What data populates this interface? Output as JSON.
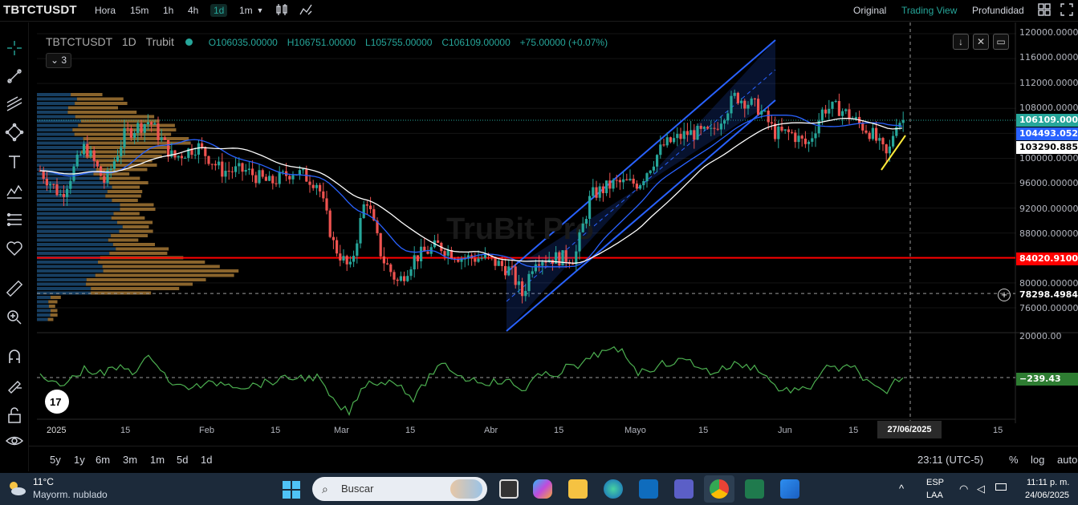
{
  "toolbar": {
    "symbol": "TBTCTUSDT",
    "timeframes": [
      "Hora",
      "15m",
      "1h",
      "4h",
      "1d",
      "1m"
    ],
    "active_timeframe": "1d",
    "view_modes": [
      "Original",
      "Trading View",
      "Profundidad"
    ],
    "active_view_mode": "Trading View"
  },
  "legend": {
    "symbol": "TBTCTUSDT",
    "interval": "1D",
    "exchange": "Trubit",
    "open": "O106035.00000",
    "high": "H106751.00000",
    "low": "L105755.00000",
    "close": "C106109.00000",
    "change": "+75.00000 (+0.07%)",
    "indicators_count": "3"
  },
  "watermark": "TruBit Pro",
  "price_axis": {
    "labels": [
      "120000.00000",
      "116000.00000",
      "112000.00000",
      "108000.00000",
      "100000.00000",
      "96000.00000",
      "92000.00000",
      "88000.00000",
      "80000.00000",
      "76000.00000"
    ],
    "last_price": "106109.00000",
    "ma_blue": "104493.05247",
    "ma_white": "103290.88594",
    "support_level": "84020.91000",
    "crosshair_price": "78298.49845"
  },
  "oscillator": {
    "top_label": "20000.00",
    "value": "−239.43"
  },
  "time_axis": {
    "labels": [
      "2025",
      "15",
      "Feb",
      "15",
      "Mar",
      "15",
      "Abr",
      "15",
      "Mayo",
      "15",
      "Jun",
      "15",
      "15"
    ],
    "crosshair_date": "27/06/2025"
  },
  "bottom_bar": {
    "ranges": [
      "5y",
      "1y",
      "6m",
      "3m",
      "1m",
      "5d",
      "1d"
    ],
    "time": "23:11 (UTC-5)",
    "percent": "%",
    "log": "log",
    "auto": "auto"
  },
  "taskbar": {
    "temperature": "11°C",
    "weather": "Mayorm. nublado",
    "search_placeholder": "Buscar",
    "lang_top": "ESP",
    "lang_bottom": "LAA",
    "clock_time": "11:11 p. m.",
    "clock_date": "24/06/2025"
  },
  "colors": {
    "up": "#26a69a",
    "down": "#ef5350",
    "channel": "#2962ff",
    "support": "#ff0000",
    "ma_blue": "#2962ff",
    "ma_white": "#ffffff"
  }
}
